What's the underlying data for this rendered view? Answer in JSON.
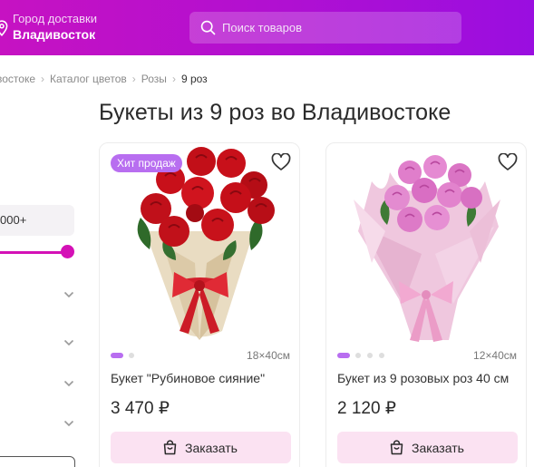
{
  "header": {
    "city_caption": "Город доставки",
    "city_name": "Владивосток",
    "search_placeholder": "Поиск товаров",
    "colors": {
      "gradient_start": "#c612c2",
      "gradient_end": "#9a0ee0"
    }
  },
  "breadcrumbs": [
    {
      "label": "востоке"
    },
    {
      "label": "Каталог цветов"
    },
    {
      "label": "Розы"
    },
    {
      "label": "9 роз",
      "current": true
    }
  ],
  "page_title": "Букеты из 9 роз во Владивостоке",
  "filters": {
    "price_value": "000+",
    "accent_color": "#d411b6",
    "collapsed_sections": 4
  },
  "products": [
    {
      "badge": "Хит продаж",
      "image": "red-roses-bouquet",
      "size": "18×40см",
      "name": "Букет \"Рубиновое сияние\"",
      "price": "3 470 ₽",
      "order_label": "Заказать",
      "slides_total": 2,
      "slide_active": 1
    },
    {
      "image": "pink-roses-bouquet",
      "size": "12×40см",
      "name": "Букет из 9 розовых роз 40 см",
      "price": "2 120 ₽",
      "order_label": "Заказать",
      "slides_total": 4,
      "slide_active": 1
    }
  ],
  "colors": {
    "badge": "#b86ef0",
    "order_button": "#fbe2f2",
    "heart_outline": "#333333"
  }
}
